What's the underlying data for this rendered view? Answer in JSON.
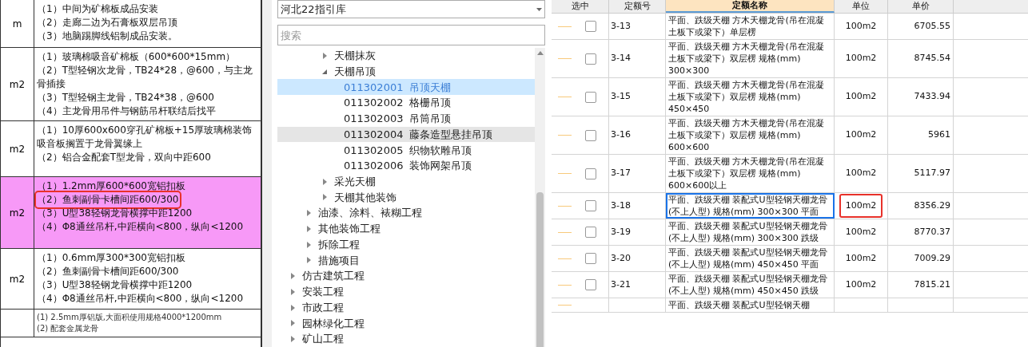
{
  "left_table": {
    "rows": [
      {
        "unit": "m",
        "highlighted": false,
        "lines": [
          {
            "text": "（1）中间为矿棉板成品安装",
            "marked": false
          },
          {
            "text": "（2）走廊二边为石膏板双层吊顶",
            "marked": false
          },
          {
            "text": "（3）地脑踢脚线铝制成品安装。",
            "marked": false
          }
        ]
      },
      {
        "unit": "m2",
        "highlighted": false,
        "lines": [
          {
            "text": "（1）玻璃棉吸音矿棉板（600*600*15mm）",
            "marked": false
          },
          {
            "text": "（2）T型轻钢次龙骨，TB24*28，@600，与主龙骨插接",
            "marked": false
          },
          {
            "text": "（3）T型轻钢主龙骨，TB24*38，@600",
            "marked": false
          },
          {
            "text": "（4）主龙骨用吊件与钢筋吊杆联结后找平",
            "marked": false
          }
        ]
      },
      {
        "unit": "m2",
        "highlighted": false,
        "lines": [
          {
            "text": "（1）10厚600x600穿孔矿棉板+15厚玻璃棉装饰吸音板搁置于龙骨翼缘上",
            "marked": false
          },
          {
            "text": "（2）铝合金配套T型龙骨，双向中距600",
            "marked": false
          }
        ]
      },
      {
        "unit": "m2",
        "highlighted": true,
        "lines": [
          {
            "text": "（1）1.2mm厚600*600宽铝扣板",
            "marked": false
          },
          {
            "text": "（2）鱼刺副骨卡槽间距600/300",
            "marked": true
          },
          {
            "text": "（3）U型38轻钢龙骨横撑中距1200",
            "marked": false
          },
          {
            "text": "（4）Φ8通丝吊杆,中距横向<800，纵向<1200",
            "marked": false
          }
        ]
      },
      {
        "unit": "m2",
        "highlighted": false,
        "lines": [
          {
            "text": "（1）0.6mm厚300*300宽铝扣板",
            "marked": false
          },
          {
            "text": "（2）鱼刺副骨卡槽间距600/300",
            "marked": false
          },
          {
            "text": "（3）U型38轻钢龙骨横撑中距1200",
            "marked": false
          },
          {
            "text": "（4）Φ8通丝吊杆,中距横向<800，纵向<1200",
            "marked": false
          }
        ]
      },
      {
        "unit": "",
        "highlighted": false,
        "kind": "note",
        "lines": [
          {
            "text": "(1) 2.5mm厚铝版,大面积使用规格4000*1200mm",
            "marked": false
          },
          {
            "text": "(2) 配套金属龙骨",
            "marked": false
          }
        ]
      }
    ]
  },
  "library_select": {
    "value": "河北22指引库"
  },
  "search": {
    "placeholder": "搜索"
  },
  "tree": {
    "group_items": [
      {
        "label": "天棚抹灰",
        "expanded": false
      },
      {
        "label": "天棚吊顶",
        "expanded": true,
        "children": [
          {
            "code": "011302001",
            "label": "吊顶天棚",
            "selected": true,
            "hovered": false
          },
          {
            "code": "011302002",
            "label": "格栅吊顶",
            "selected": false,
            "hovered": false
          },
          {
            "code": "011302003",
            "label": "吊筒吊顶",
            "selected": false,
            "hovered": false
          },
          {
            "code": "011302004",
            "label": "藤条造型悬挂吊顶",
            "selected": false,
            "hovered": true
          },
          {
            "code": "011302005",
            "label": "织物软雕吊顶",
            "selected": false,
            "hovered": false
          },
          {
            "code": "011302006",
            "label": "装饰网架吊顶",
            "selected": false,
            "hovered": false
          }
        ]
      },
      {
        "label": "采光天棚",
        "expanded": false
      },
      {
        "label": "天棚其他装饰",
        "expanded": false
      }
    ],
    "section_items": [
      {
        "label": "油漆、涂料、裱糊工程",
        "expanded": false
      },
      {
        "label": "其他装饰工程",
        "expanded": false
      },
      {
        "label": "拆除工程",
        "expanded": false
      },
      {
        "label": "措施项目",
        "expanded": false
      }
    ],
    "root_items": [
      {
        "label": "仿古建筑工程",
        "expanded": false
      },
      {
        "label": "安装工程",
        "expanded": false
      },
      {
        "label": "市政工程",
        "expanded": false
      },
      {
        "label": "园林绿化工程",
        "expanded": false
      },
      {
        "label": "矿山工程",
        "expanded": false
      }
    ]
  },
  "quota_table": {
    "columns": [
      "选中",
      "定额号",
      "定额名称",
      "单位",
      "单价"
    ],
    "rows": [
      {
        "checked": false,
        "selected": false,
        "marked": false,
        "code": "3-13",
        "name": "平面、跌级天棚 方木天棚龙骨(吊在混凝土板下或梁下）单层楞",
        "unit": "100m2",
        "price": "6705.55"
      },
      {
        "checked": false,
        "selected": false,
        "marked": false,
        "code": "3-14",
        "name": "平面、跌级天棚 方木天棚龙骨(吊在混凝土板下或梁下）双层楞 规格(mm) 300×300",
        "unit": "100m2",
        "price": "8745.54"
      },
      {
        "checked": false,
        "selected": false,
        "marked": false,
        "code": "3-15",
        "name": "平面、跌级天棚 方木天棚龙骨(吊在混凝土板下或梁下）双层楞 规格(mm) 450×450",
        "unit": "100m2",
        "price": "7433.94"
      },
      {
        "checked": false,
        "selected": false,
        "marked": false,
        "code": "3-16",
        "name": "平面、跌级天棚 方木天棚龙骨(吊在混凝土板下或梁下）双层楞 规格(mm) 600×600",
        "unit": "100m2",
        "price": "5961"
      },
      {
        "checked": false,
        "selected": false,
        "marked": false,
        "code": "3-17",
        "name": "平面、跌级天棚 方木天棚龙骨(吊在混凝土板下或梁下）双层楞 规格(mm) 600×600以上",
        "unit": "100m2",
        "price": "5117.97"
      },
      {
        "checked": false,
        "selected": true,
        "marked": true,
        "code": "3-18",
        "name": "平面、跌级天棚 装配式U型轻钢天棚龙骨(不上人型) 规格(mm) 300×300 平面",
        "unit": "100m2",
        "price": "8356.29"
      },
      {
        "checked": false,
        "selected": false,
        "marked": false,
        "code": "3-19",
        "name": "平面、跌级天棚 装配式U型轻钢天棚龙骨(不上人型) 规格(mm) 300×300 跌级",
        "unit": "100m2",
        "price": "8770.37"
      },
      {
        "checked": false,
        "selected": false,
        "marked": false,
        "code": "3-20",
        "name": "平面、跌级天棚 装配式U型轻钢天棚龙骨(不上人型) 规格(mm) 450×450 平面",
        "unit": "100m2",
        "price": "7009.29"
      },
      {
        "checked": false,
        "selected": false,
        "marked": false,
        "code": "3-21",
        "name": "平面、跌级天棚 装配式U型轻钢天棚龙骨(不上人型) 规格(mm) 450×450 跌级",
        "unit": "100m2",
        "price": "7815.21"
      },
      {
        "name": "平面、跌级天棚 装配式U型轻钢天棚"
      }
    ]
  }
}
